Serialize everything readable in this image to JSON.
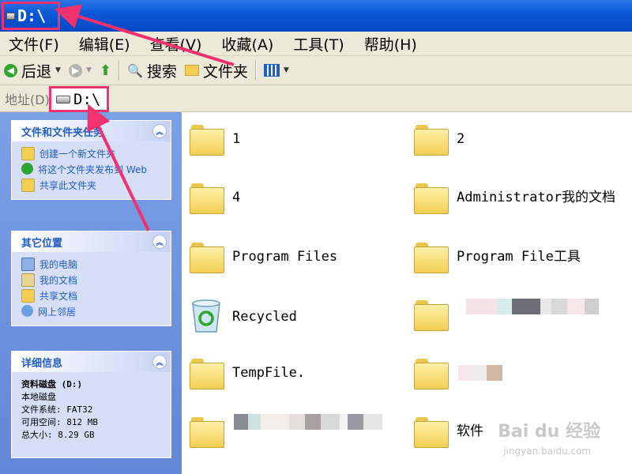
{
  "window": {
    "title": "D:\\"
  },
  "menu": [
    "文件(F)",
    "编辑(E)",
    "查看(V)",
    "收藏(A)",
    "工具(T)",
    "帮助(H)"
  ],
  "toolbar": {
    "back_label": "后退",
    "search_label": "搜索",
    "folders_label": "文件夹"
  },
  "address": {
    "label": "地址(D)",
    "value": "D:\\"
  },
  "tasks_panel": {
    "title": "文件和文件夹任务",
    "items": [
      "创建一个新文件夹",
      "将这个文件夹发布到 Web",
      "共享此文件夹"
    ]
  },
  "places_panel": {
    "title": "其它位置",
    "items": [
      "我的电脑",
      "我的文档",
      "共享文档",
      "网上邻居"
    ]
  },
  "details_panel": {
    "title": "详细信息",
    "name": "资料磁盘 (D:)",
    "type": "本地磁盘",
    "filesystem": "文件系统: FAT32",
    "free": "可用空间: 812 MB",
    "total": "总大小: 8.29 GB"
  },
  "files": [
    {
      "name": "1",
      "icon": "folder-icon"
    },
    {
      "name": "2",
      "icon": "folder-icon"
    },
    {
      "name": "4",
      "icon": "folder-icon"
    },
    {
      "name": "Administrator我的文档",
      "icon": "folder-icon"
    },
    {
      "name": "Program Files",
      "icon": "folder-icon"
    },
    {
      "name": "Program File工具",
      "icon": "folder-icon"
    },
    {
      "name": "Recycled",
      "icon": "recycle-bin-icon"
    },
    {
      "name": "",
      "icon": "folder-icon"
    },
    {
      "name": "TempFile.",
      "icon": "folder-icon"
    },
    {
      "name": "",
      "icon": "folder-icon"
    },
    {
      "name": "",
      "icon": "folder-icon"
    },
    {
      "name": "软件",
      "icon": "folder-icon"
    }
  ],
  "watermark": {
    "brand": "Bai du 经验",
    "url": "jingyan.baidu.com"
  },
  "colors": {
    "titlebar": "#0a56d6",
    "highlight": "#f2326f",
    "link": "#215dc6",
    "pane": "#6f92dc"
  }
}
